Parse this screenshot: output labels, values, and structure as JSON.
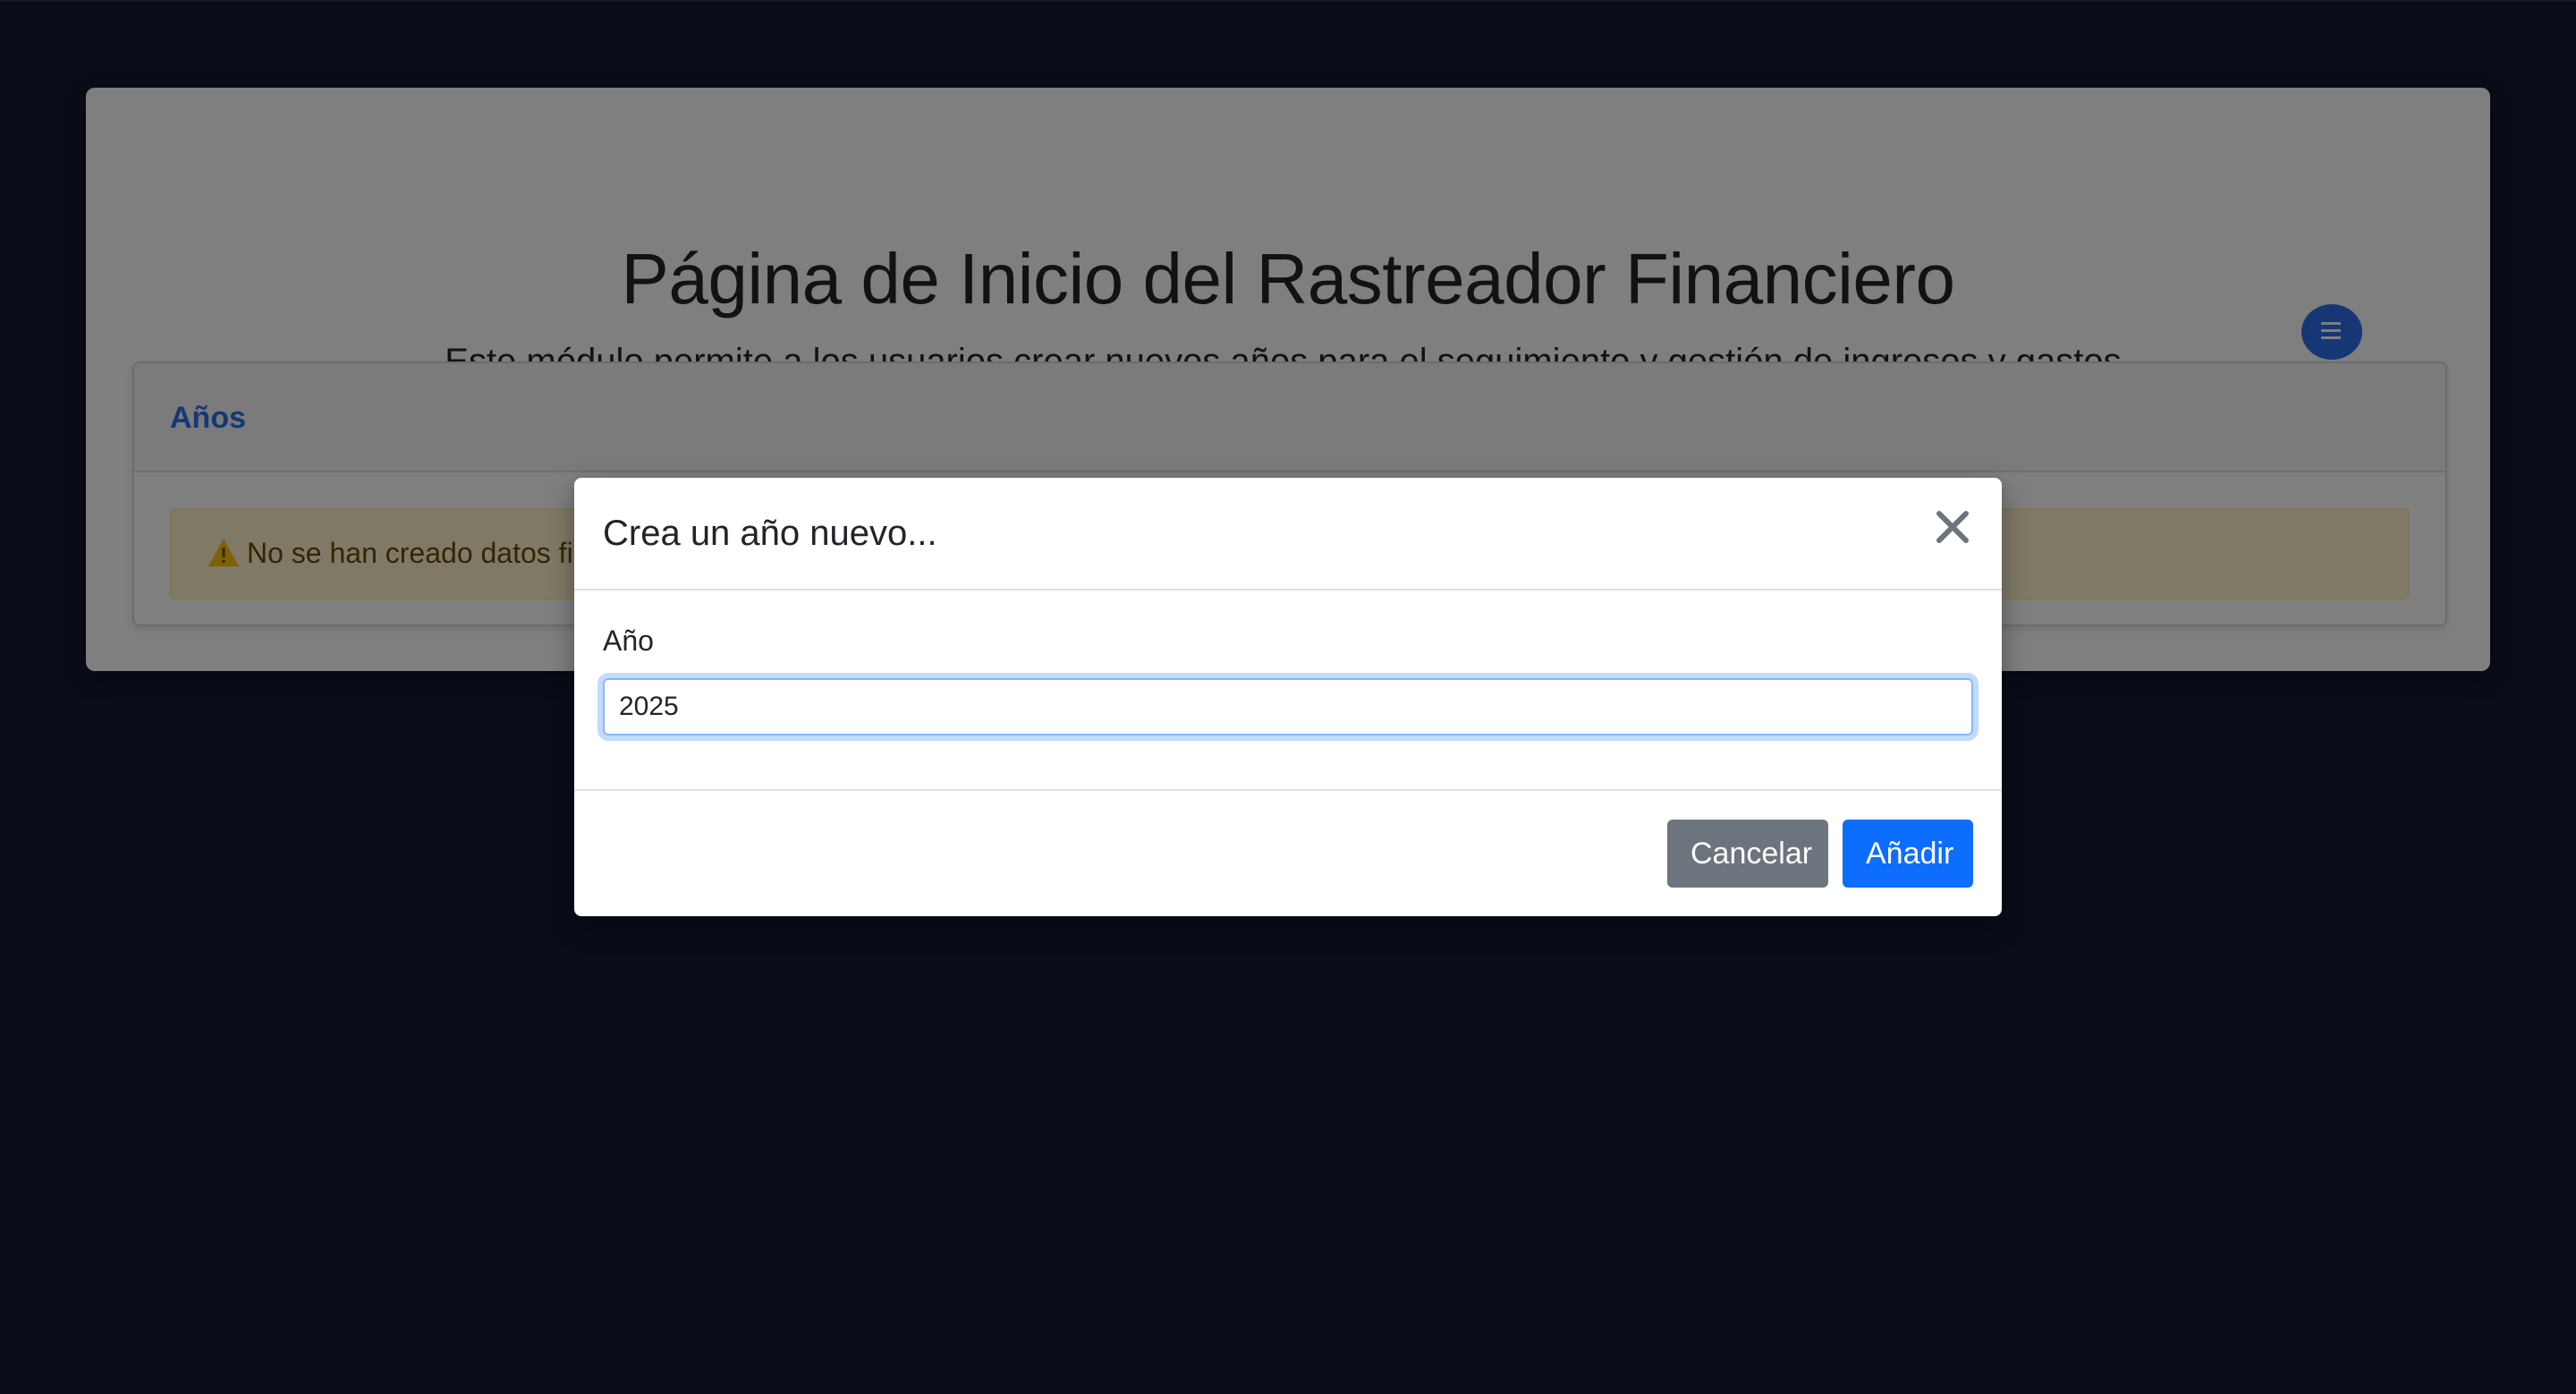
{
  "page": {
    "title": "Página de Inicio del Rastreador Financiero",
    "subtitle": "Este módulo permite a los usuarios crear nuevos años para el seguimiento y gestión de ingresos y gastos."
  },
  "years_card": {
    "title": "Años",
    "menu_icon": "list-icon",
    "alert": {
      "icon": "warning-triangle-icon",
      "text": "No se han creado datos fi"
    }
  },
  "modal": {
    "title": "Crea un año nuevo...",
    "close_icon": "close-icon",
    "field_label": "Año",
    "year_value": "2025",
    "cancel_label": "Cancelar",
    "add_label": "Añadir"
  },
  "colors": {
    "background": "#121a33",
    "primary": "#0d6efd",
    "secondary": "#6c757d",
    "warning_bg": "#fff3cd",
    "warning_icon": "#ffc107"
  }
}
